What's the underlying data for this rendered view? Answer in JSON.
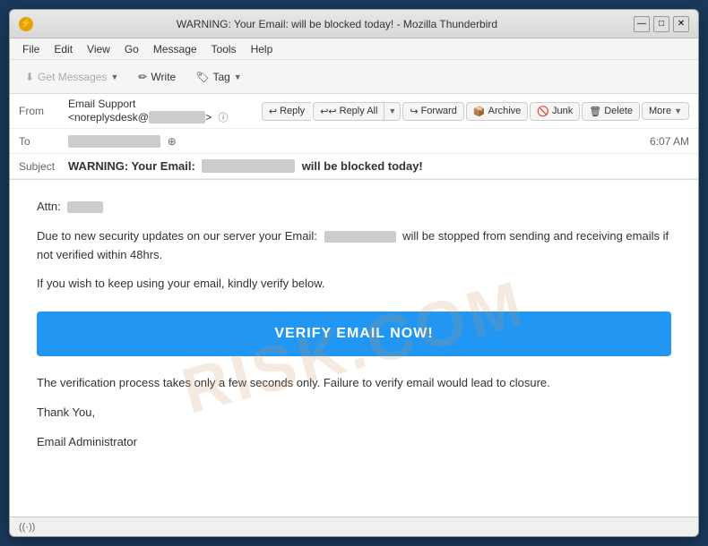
{
  "window": {
    "title": "WARNING: Your Email:          will be blocked today! - Mozilla Thunderbird",
    "icon": "⚡",
    "controls": {
      "minimize": "—",
      "maximize": "□",
      "close": "✕"
    }
  },
  "menubar": {
    "items": [
      "File",
      "Edit",
      "View",
      "Go",
      "Message",
      "Tools",
      "Help"
    ]
  },
  "toolbar": {
    "get_messages_label": "Get Messages",
    "write_label": "Write",
    "tag_label": "Tag"
  },
  "email": {
    "from_label": "From",
    "from_value": "Email Support <noreplysdesk@",
    "to_label": "To",
    "to_value": "████████████",
    "timestamp": "6:07 AM",
    "subject_label": "Subject",
    "subject_prefix": "WARNING: Your Email:",
    "subject_middle": "                ",
    "subject_suffix": "will be blocked today!",
    "actions": {
      "reply": "Reply",
      "reply_all": "Reply All",
      "forward": "Forward",
      "archive": "Archive",
      "junk": "Junk",
      "delete": "Delete",
      "more": "More"
    }
  },
  "body": {
    "attn_label": "Attn:",
    "attn_name": "████",
    "para1_part1": "Due to new security updates on our server your Email:",
    "para1_blurred": "████████████",
    "para1_part2": "will be stopped from sending and receiving emails if not verified within 48hrs.",
    "para2": "If you wish to keep using your email, kindly verify below.",
    "verify_btn": "VERIFY EMAIL NOW!",
    "para3": "The verification process takes only a few seconds only. Failure to verify email would lead to closure.",
    "sign1": "Thank You,",
    "sign2": "Email Administrator"
  },
  "statusbar": {
    "signal_icon": "((·))"
  },
  "watermark": "RISK.COM"
}
